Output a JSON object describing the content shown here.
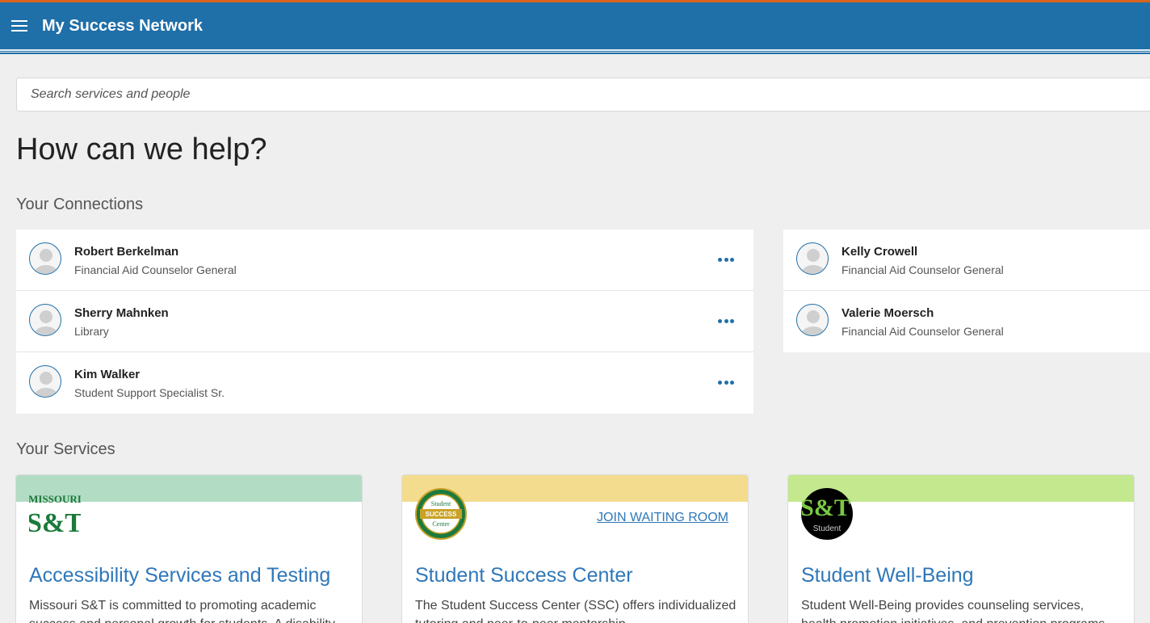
{
  "header": {
    "title": "My Success Network"
  },
  "search": {
    "placeholder": "Search services and people"
  },
  "page": {
    "title": "How can we help?"
  },
  "connections": {
    "title": "Your Connections",
    "left": [
      {
        "name": "Robert Berkelman",
        "role": "Financial Aid Counselor General"
      },
      {
        "name": "Sherry Mahnken",
        "role": "Library"
      },
      {
        "name": "Kim Walker",
        "role": "Student Support Specialist Sr."
      }
    ],
    "right": [
      {
        "name": "Kelly Crowell",
        "role": "Financial Aid Counselor General"
      },
      {
        "name": "Valerie Moersch",
        "role": "Financial Aid Counselor General"
      }
    ]
  },
  "services": {
    "title": "Your Services",
    "cards": [
      {
        "title": "Accessibility Services and Testing",
        "desc": "Missouri S&T is committed to promoting academic success and personal growth for students. A disability",
        "band_color": "#b3dcc4",
        "logo_text_top": "MISSOURI",
        "logo_text_main": "S&T"
      },
      {
        "title": "Student Success Center",
        "desc": "The Student Success Center (SSC) offers individualized tutoring and peer-to-peer mentorship",
        "band_color": "#f4dc8e",
        "action": "JOIN WAITING ROOM",
        "logo_text_top": "Student",
        "logo_text_main": "SUCCESS",
        "logo_text_bottom": "Center"
      },
      {
        "title": "Student Well-Being",
        "desc": "Student Well-Being provides counseling services, health promotion initiatives, and prevention programs",
        "band_color": "#c3e88e",
        "logo_text_main": "S&T",
        "logo_text_bottom": "Student"
      }
    ]
  },
  "colors": {
    "header_bg": "#1f6fa8",
    "header_accent": "#d9651e",
    "link": "#2f77b9"
  }
}
